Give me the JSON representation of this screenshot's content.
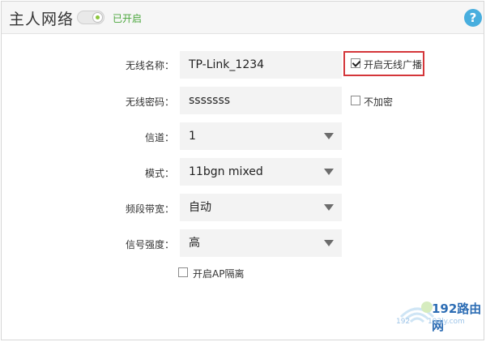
{
  "header": {
    "title": "主人网络",
    "status": "已开启",
    "help_symbol": "?"
  },
  "form": {
    "ssid": {
      "label": "无线名称：",
      "value": "TP-Link_1234"
    },
    "broadcast": {
      "label": "开启无线广播",
      "checked": true
    },
    "password": {
      "label": "无线密码：",
      "value": "sssssss"
    },
    "no_encrypt": {
      "label": "不加密",
      "checked": false
    },
    "channel": {
      "label": "信道：",
      "value": "1"
    },
    "mode": {
      "label": "模式：",
      "value": "11bgn mixed"
    },
    "bandwidth": {
      "label": "频段带宽：",
      "value": "自动"
    },
    "signal": {
      "label": "信号强度：",
      "value": "高"
    },
    "ap_isolation": {
      "label": "开启AP隔离",
      "checked": false
    }
  },
  "watermark": {
    "text": "192路由网",
    "sub": "192ly.com",
    "left": "192"
  },
  "colors": {
    "status_green": "#4aa63c",
    "help_blue": "#48aede",
    "highlight_red": "#d4363a",
    "field_bg": "#f3f3f3"
  },
  "icons": [
    "toggle-icon",
    "help-icon",
    "dropdown-arrow-icon",
    "checkbox-icon",
    "wifi-watermark-icon"
  ]
}
